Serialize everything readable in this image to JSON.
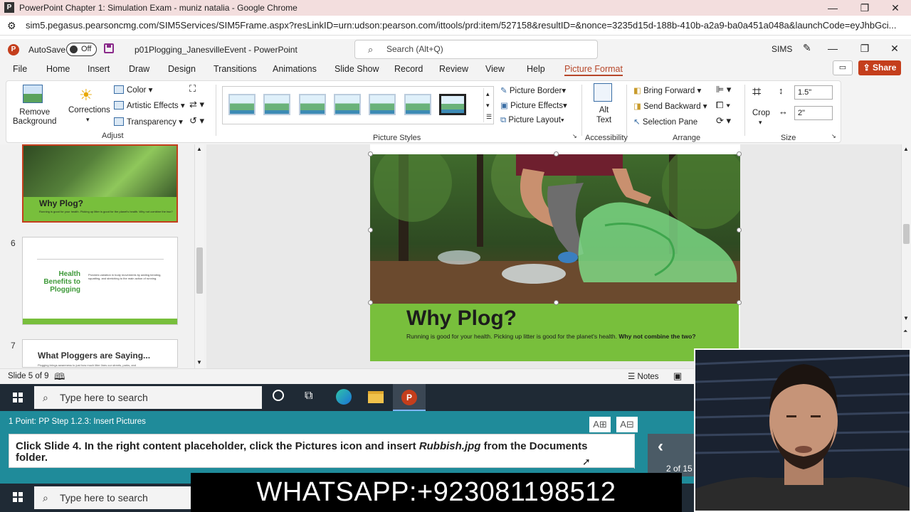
{
  "browser": {
    "window_title": "PowerPoint Chapter 1: Simulation Exam - muniz natalia - Google Chrome",
    "url": "sim5.pegasus.pearsoncmg.com/SIM5Services/SIM5Frame.aspx?resLinkID=urn:udson:pearson.com/ittools/prd:item/527158&resultID=&nonce=3235d15d-188b-410b-a2a9-ba0a451a048a&launchCode=eyJhbGci...",
    "favicon_letter": "P"
  },
  "ppt": {
    "autosave_label": "AutoSave",
    "autosave_state": "Off",
    "doc_name": "p01Plogging_JanesvilleEvent - PowerPoint",
    "search_placeholder": "Search (Alt+Q)",
    "user": "SIMS",
    "share_label": "Share"
  },
  "tabs": [
    "File",
    "Home",
    "Insert",
    "Draw",
    "Design",
    "Transitions",
    "Animations",
    "Slide Show",
    "Record",
    "Review",
    "View",
    "Help",
    "Picture Format"
  ],
  "ribbon": {
    "remove_bg": "Remove Background",
    "remove_bg_l1": "Remove",
    "remove_bg_l2": "Background",
    "corrections": "Corrections",
    "color": "Color",
    "artistic": "Artistic Effects",
    "transparency": "Transparency",
    "adjust_label": "Adjust",
    "picture_styles_label": "Picture Styles",
    "picture_border": "Picture Border",
    "picture_effects": "Picture Effects",
    "picture_layout": "Picture Layout",
    "alt_text_l1": "Alt",
    "alt_text_l2": "Text",
    "accessibility_label": "Accessibility",
    "bring_forward": "Bring Forward",
    "send_backward": "Send Backward",
    "selection_pane": "Selection Pane",
    "arrange_label": "Arrange",
    "crop": "Crop",
    "height": "1.5\"",
    "width": "2\"",
    "size_label": "Size"
  },
  "thumbnails": {
    "slide5_title": "Why Plog?",
    "slide5_text": "Running is good for your health. Picking up litter is good for the planet's health. Why not combine the two?",
    "slide6_num": "6",
    "slide6_title": "Health Benefits to Plogging",
    "slide6_text": "Provides variation in body movements by adding bending, squatting, and stretching to the main action of running.",
    "slide7_num": "7",
    "slide7_title": "What Ploggers are Saying...",
    "slide7_text": "Plogging brings awareness to just how much litter lines our streets, parks, and"
  },
  "slide": {
    "title": "Why Plog?",
    "body_plain": "Running is good for your health.  Picking up litter is good for the planet's health.",
    "body_bold": "Why not combine the two?"
  },
  "status": {
    "slide_counter": "Slide 5 of 9",
    "notes": "Notes"
  },
  "taskbar": {
    "search_placeholder": "Type here to search"
  },
  "instructions": {
    "header": "1 Point: PP Step 1.2.3: Insert Pictures",
    "text_part1": "Click Slide 4. In the right content placeholder, click the Pictures icon and insert ",
    "text_file": "Rubbish.jpg",
    "text_part2": " from the Documents folder.",
    "font_up": "A",
    "font_down": "A",
    "pager": "2 of 15"
  },
  "banner": {
    "text": "WHATSAPP:+923081198512"
  },
  "colors": {
    "accent": "#b7472a",
    "ppt_red": "#c43e1c",
    "slide_green": "#78bf3c",
    "instruction_teal": "#1f8b9a",
    "taskbar": "#1f2a35"
  }
}
